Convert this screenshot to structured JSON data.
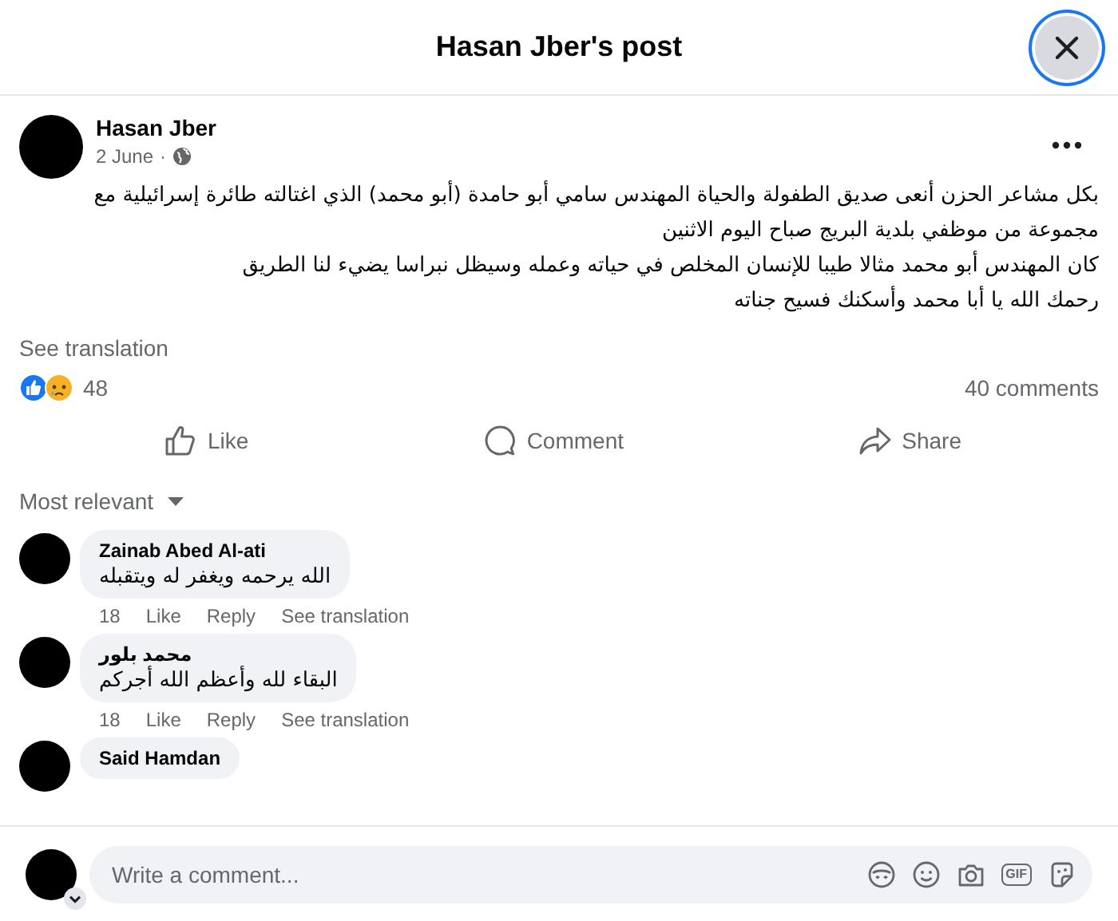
{
  "dialog": {
    "title": "Hasan Jber's post"
  },
  "post": {
    "author": "Hasan Jber",
    "date": "2 June",
    "date_separator": "·",
    "paragraphs": [
      "بكل مشاعر الحزن أنعى صديق الطفولة والحياة المهندس سامي أبو حامدة (أبو محمد) الذي اغتالته طائرة إسرائيلية مع مجموعة من موظفي بلدية البريج صباح اليوم الاثنين",
      "كان المهندس أبو محمد مثالا طيبا للإنسان المخلص في حياته وعمله وسيظل نبراسا يضيء لنا الطريق",
      "رحمك الله يا أبا محمد وأسكنك فسيح جناته"
    ],
    "see_translation": "See translation",
    "reaction_count": "48",
    "comment_count": "40 comments"
  },
  "actions": [
    {
      "kind": "like",
      "label": "Like"
    },
    {
      "kind": "comment",
      "label": "Comment"
    },
    {
      "kind": "share",
      "label": "Share"
    }
  ],
  "sort": {
    "label": "Most relevant"
  },
  "comments": [
    {
      "author": "Zainab Abed Al-ati",
      "text": "الله يرحمه ويغفر له ويتقبله",
      "likes": "18",
      "like": "Like",
      "reply": "Reply",
      "translate": "See translation"
    },
    {
      "author": "محمد بلور",
      "text": "البقاء لله وأعظم الله أجركم",
      "likes": "18",
      "like": "Like",
      "reply": "Reply",
      "translate": "See translation"
    },
    {
      "author": "Said Hamdan"
    }
  ],
  "composer": {
    "placeholder": "Write a comment...",
    "gif_label": "GIF"
  }
}
